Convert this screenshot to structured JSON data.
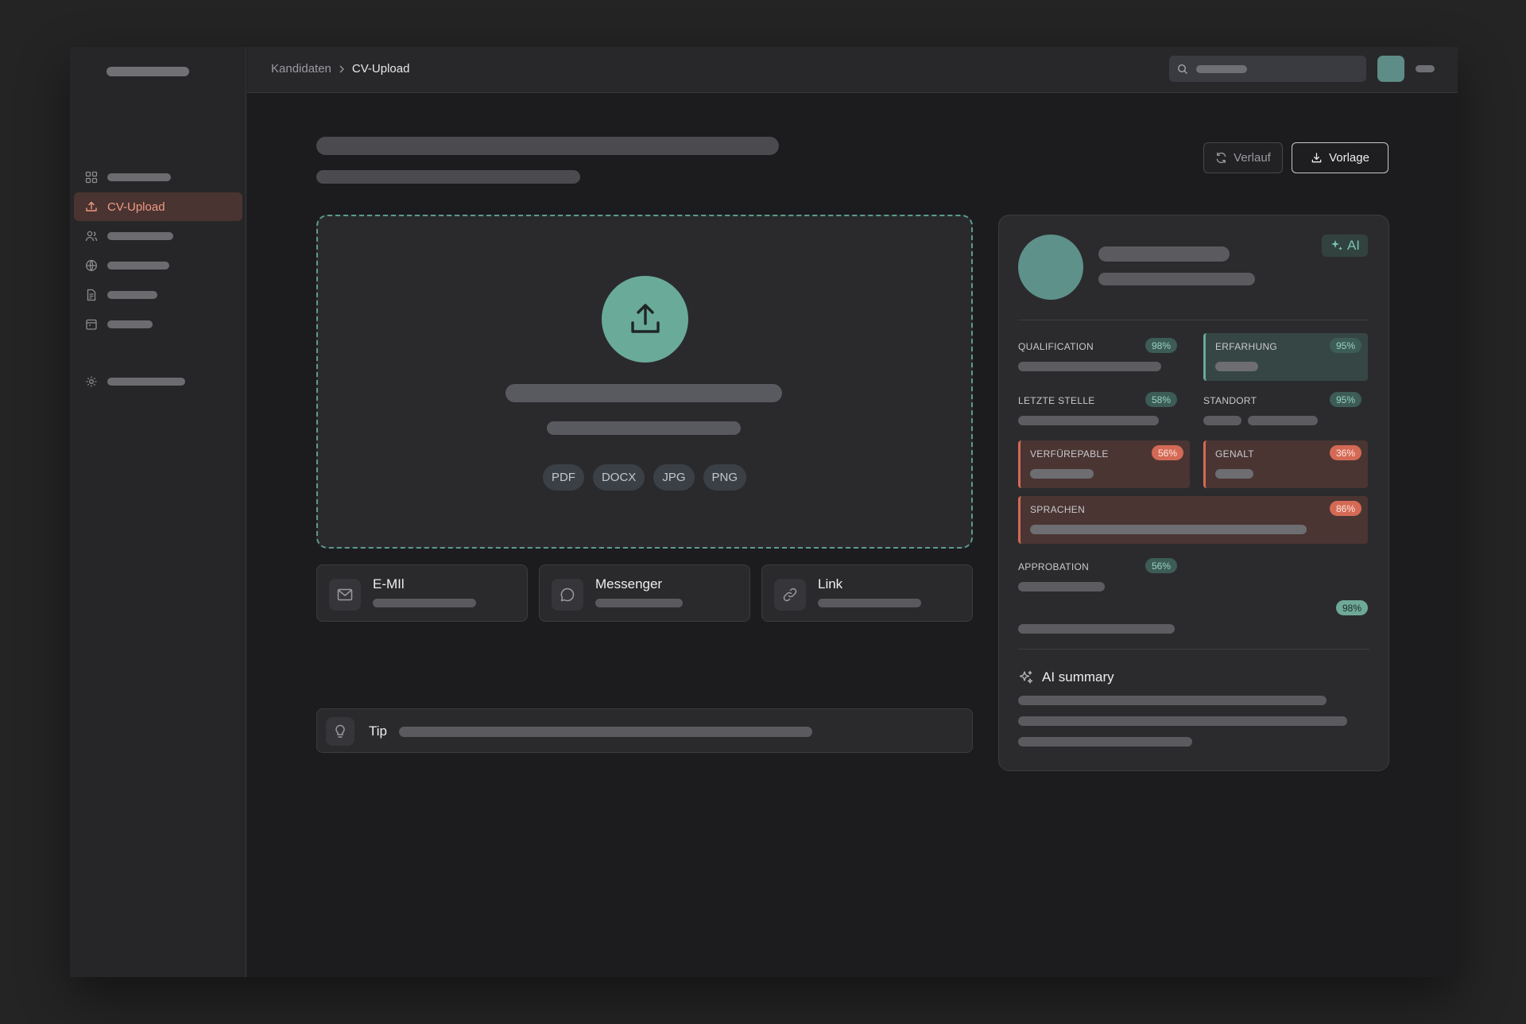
{
  "breadcrumb": {
    "parent": "Kandidaten",
    "current": "CV-Upload"
  },
  "sidebar": {
    "active_label": "CV-Upload"
  },
  "header": {
    "verlauf_label": "Verlauf",
    "vorlage_label": "Vorlage"
  },
  "dropzone": {
    "formats": [
      "PDF",
      "DOCX",
      "JPG",
      "PNG"
    ]
  },
  "channels": [
    {
      "label": "E-MIl",
      "icon": "mail-icon"
    },
    {
      "label": "Messenger",
      "icon": "chat-icon"
    },
    {
      "label": "Link",
      "icon": "link-icon"
    }
  ],
  "tip": {
    "label": "Tip"
  },
  "panel": {
    "ai_badge": "AI",
    "metrics": [
      {
        "label": "QUALIFICATION",
        "pct": "98%",
        "status": "neutral"
      },
      {
        "label": "ERFARHUNG",
        "pct": "95%",
        "status": "good"
      },
      {
        "label": "LETZTE STELLE",
        "pct": "58%",
        "status": "neutral"
      },
      {
        "label": "STANDORT",
        "pct": "95%",
        "status": "neutral"
      },
      {
        "label": "VERFÜREPABLE",
        "pct": "56%",
        "status": "warn"
      },
      {
        "label": "GENALT",
        "pct": "36%",
        "status": "warn"
      },
      {
        "label": "SPRACHEN",
        "pct": "86%",
        "status": "warn"
      },
      {
        "label": "APPROBATION",
        "pct": "56%",
        "status": "neutral"
      },
      {
        "label": "",
        "pct": "98%",
        "status": "neutral"
      }
    ],
    "summary_title": "AI summary"
  },
  "colors": {
    "accent_green": "#6aaa99",
    "accent_red": "#d46a55",
    "active_nav": "#ef9a85"
  }
}
